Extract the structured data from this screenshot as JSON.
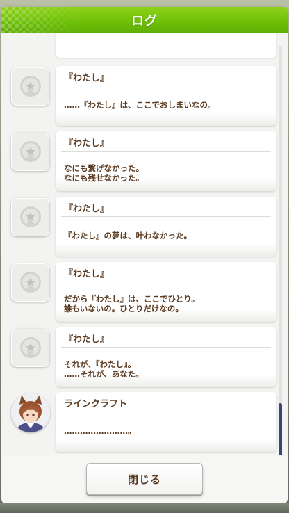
{
  "header": {
    "title": "ログ"
  },
  "log": {
    "entries": [
      {
        "speaker": "『わたし』",
        "message": "……『わたし』は、ここでおしまいなの。",
        "avatar": "placeholder-emblem-icon"
      },
      {
        "speaker": "『わたし』",
        "message": "なにも繋げなかった。\nなにも残せなかった。",
        "avatar": "placeholder-emblem-icon"
      },
      {
        "speaker": "『わたし』",
        "message": "『わたし』の夢は、叶わなかった。",
        "avatar": "placeholder-emblem-icon"
      },
      {
        "speaker": "『わたし』",
        "message": "だから『わたし』は、ここでひとり。\n誰もいないの。ひとりだけなの。",
        "avatar": "placeholder-emblem-icon"
      },
      {
        "speaker": "『わたし』",
        "message": "それが、『わたし』。\n……それが、あなた。",
        "avatar": "placeholder-emblem-icon"
      },
      {
        "speaker": "ラインクラフト",
        "message": "……………………。",
        "avatar": "character-portrait"
      }
    ],
    "scroll_position": 0.87
  },
  "footer": {
    "close_label": "閉じる"
  },
  "colors": {
    "header_green": "#6fc10a",
    "text_brown": "#5a3b21",
    "scroll_thumb": "#3a4678",
    "panel_bg": "#f3f3f1"
  }
}
